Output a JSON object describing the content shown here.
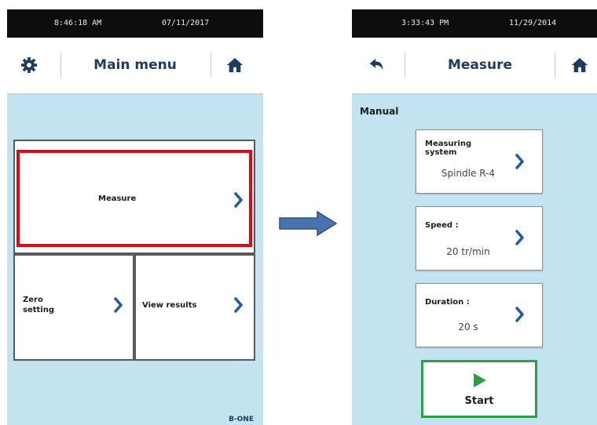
{
  "left_screen": {
    "status": {
      "time": "8:46:18 AM",
      "date": "07/11/2017"
    },
    "header": {
      "title": "Main menu",
      "left_icon": "gear-icon",
      "right_icon": "home-icon"
    },
    "tiles": {
      "measure": "Measure",
      "zero_setting": "Zero\nsetting",
      "view_results": "View results"
    },
    "highlight_color": "#e30613",
    "footer_brand": "B-ONE"
  },
  "arrow_color": "#4a72b0",
  "right_screen": {
    "status": {
      "time": "3:33:43 PM",
      "date": "11/29/2014"
    },
    "header": {
      "title": "Measure",
      "left_icon": "back-icon",
      "right_icon": "home-icon"
    },
    "mode_label": "Manual",
    "cards": [
      {
        "label": "Measuring\nsystem",
        "value": "Spindle R-4"
      },
      {
        "label": "Speed :",
        "value": "20 tr/min"
      },
      {
        "label": "Duration :",
        "value": "20 s"
      }
    ],
    "start": {
      "label": "Start",
      "border_color": "#2e9e44",
      "icon_color": "#2e9e44"
    }
  }
}
